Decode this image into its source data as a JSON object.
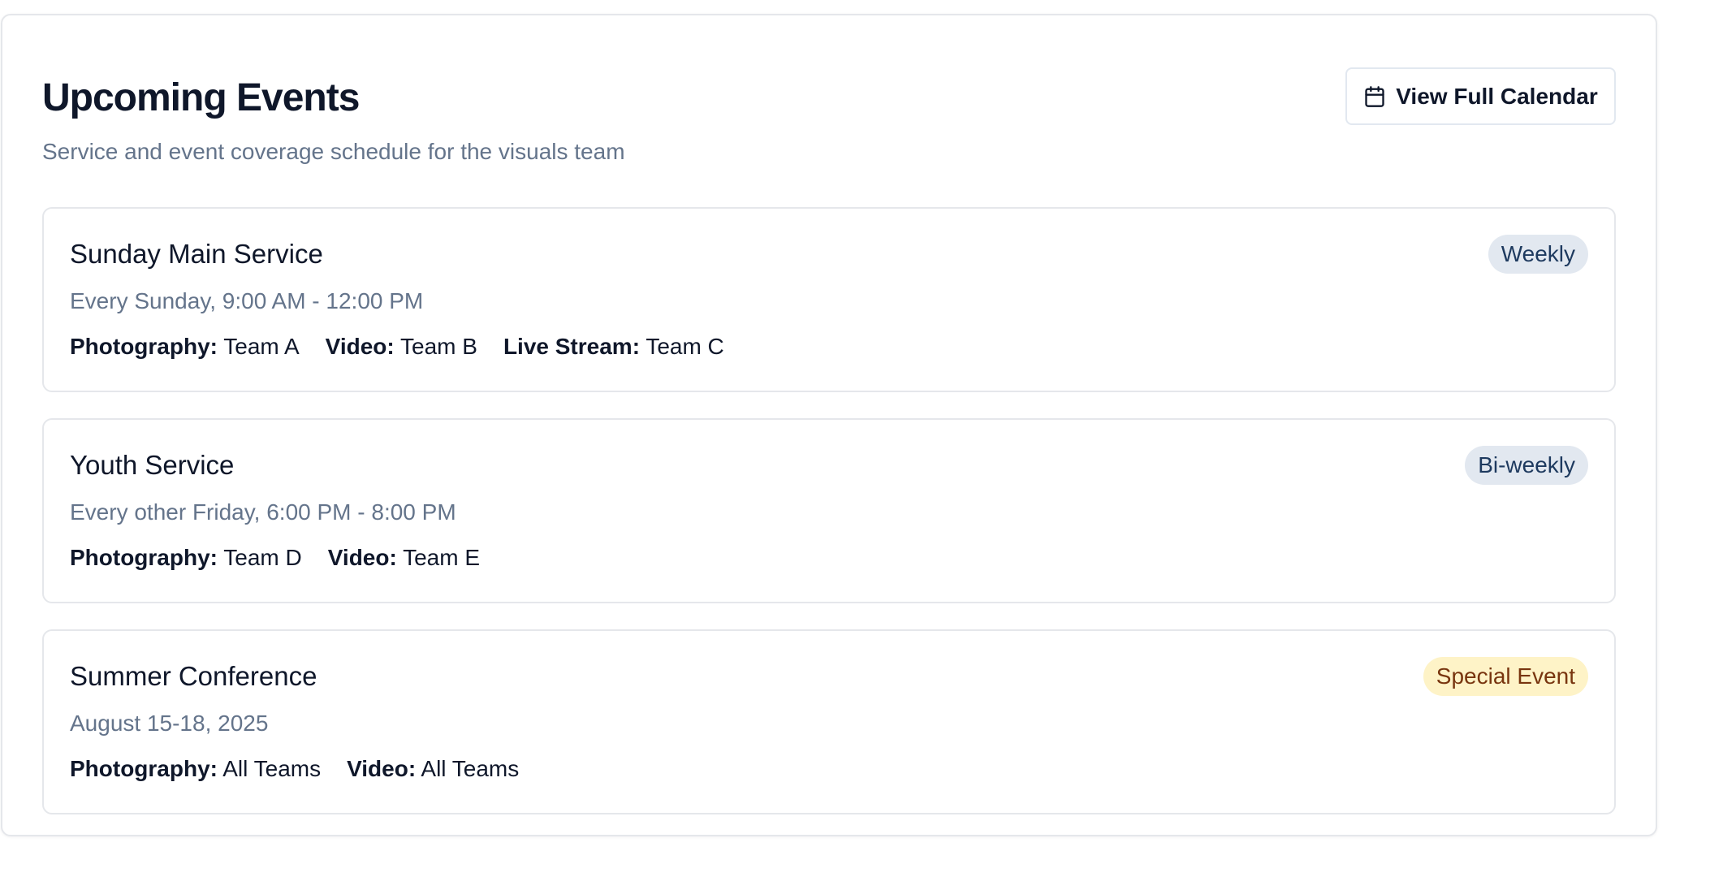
{
  "header": {
    "title": "Upcoming Events",
    "subtitle": "Service and event coverage schedule for the visuals team",
    "calendar_button_label": "View Full Calendar",
    "calendar_button_icon": "calendar-icon"
  },
  "colors": {
    "badge_default_bg": "#e2e8f0",
    "badge_default_text": "#1e3a5f",
    "badge_special_bg": "#fef3c7",
    "badge_special_text": "#78350f"
  },
  "events": [
    {
      "name": "Sunday Main Service",
      "schedule": "Every Sunday, 9:00 AM - 12:00 PM",
      "badge": "Weekly",
      "badge_variant": "default",
      "assignments": [
        {
          "role": "Photography:",
          "team": "Team A"
        },
        {
          "role": "Video:",
          "team": "Team B"
        },
        {
          "role": "Live Stream:",
          "team": "Team C"
        }
      ]
    },
    {
      "name": "Youth Service",
      "schedule": "Every other Friday, 6:00 PM - 8:00 PM",
      "badge": "Bi-weekly",
      "badge_variant": "default",
      "assignments": [
        {
          "role": "Photography:",
          "team": "Team D"
        },
        {
          "role": "Video:",
          "team": "Team E"
        }
      ]
    },
    {
      "name": "Summer Conference",
      "schedule": "August 15-18, 2025",
      "badge": "Special Event",
      "badge_variant": "special",
      "assignments": [
        {
          "role": "Photography:",
          "team": "All Teams"
        },
        {
          "role": "Video:",
          "team": "All Teams"
        }
      ]
    }
  ]
}
